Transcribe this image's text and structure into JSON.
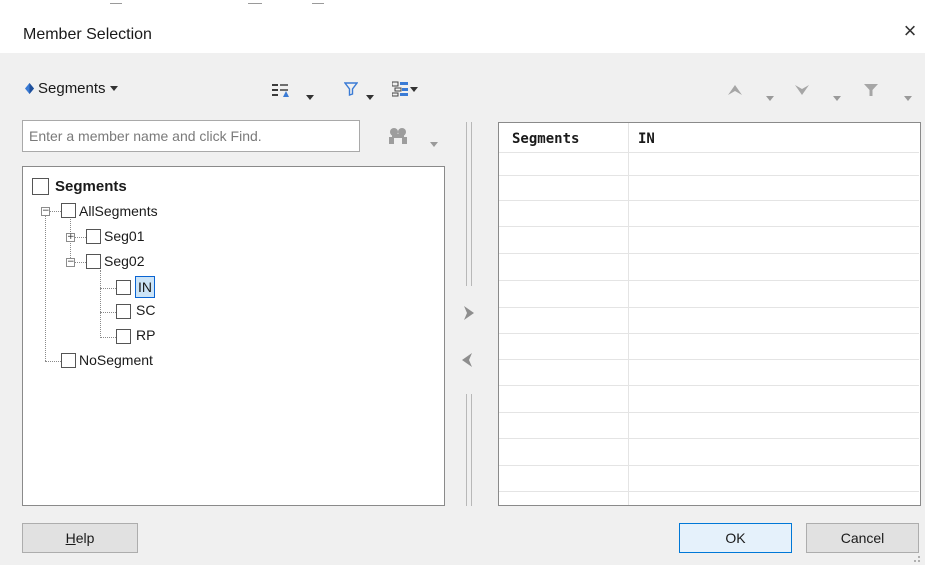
{
  "window": {
    "title": "Member Selection",
    "close_glyph": "×"
  },
  "toolbar": {
    "dimension_label": "Segments",
    "dimension_icon": "dimension-icon"
  },
  "search": {
    "placeholder": "Enter a member name and click Find."
  },
  "tree": {
    "root": "Segments",
    "all": "AllSegments",
    "seg01": "Seg01",
    "seg02": "Seg02",
    "in": "IN",
    "sc": "SC",
    "rp": "RP",
    "nosegment": "NoSegment",
    "selected": "IN"
  },
  "selection_table": {
    "columns": [
      "Segments",
      "IN"
    ],
    "rows": []
  },
  "buttons": {
    "help_mnemonic": "H",
    "help_rest": "elp",
    "ok": "OK",
    "cancel": "Cancel"
  },
  "colors": {
    "highlight": "#0a64d2",
    "selection_bg": "#cce4f7",
    "accent": "#0078d7"
  }
}
